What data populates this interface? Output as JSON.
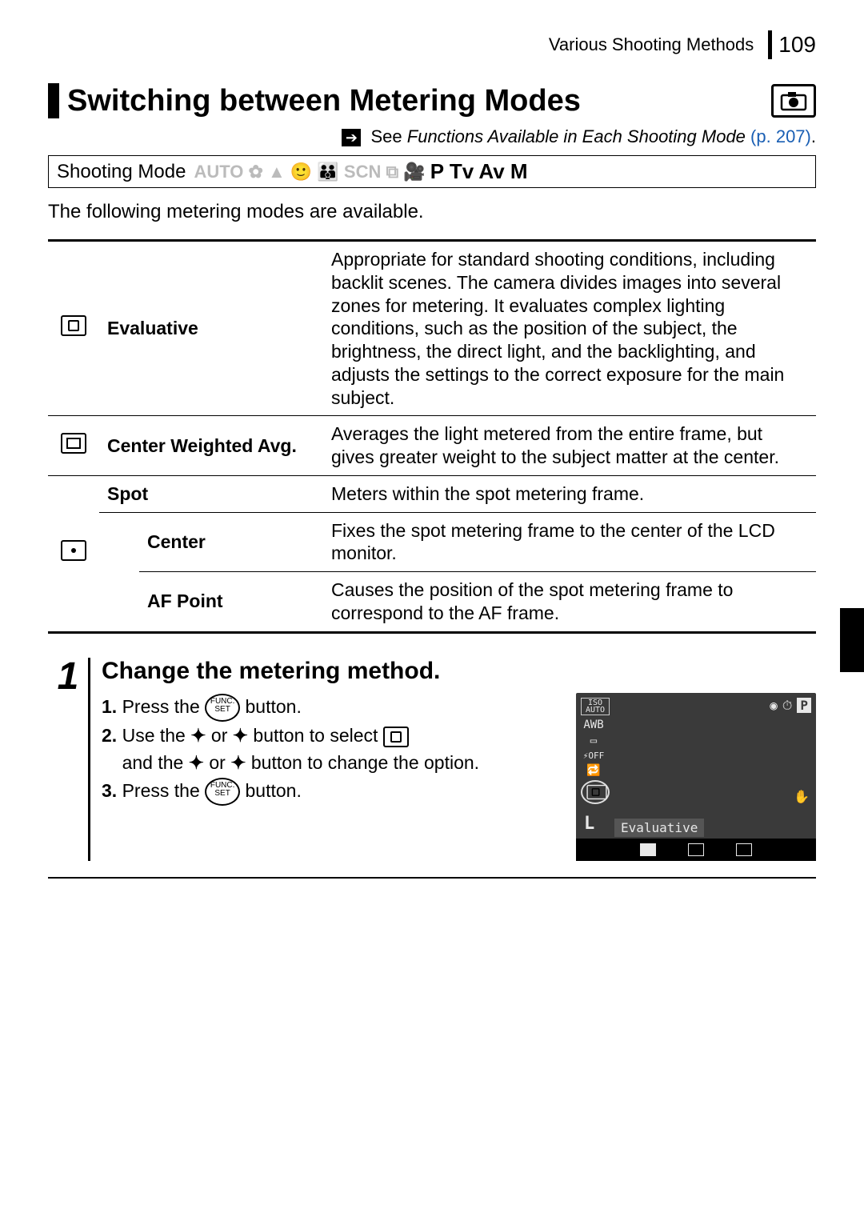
{
  "header": {
    "section_title": "Various Shooting Methods",
    "page_number": "109"
  },
  "heading": "Switching between Metering Modes",
  "see_ref": {
    "prefix": "See",
    "title": "Functions Available in Each Shooting Mode",
    "page": "(p. 207)",
    "period": "."
  },
  "shooting_mode": {
    "label": "Shooting Mode",
    "inactive_modes": "AUTO ✿ ▲ 🙂 👪 SCN ⧉ 🎥",
    "active_modes": "P Tv Av M"
  },
  "intro": "The following metering modes are available.",
  "table": {
    "evaluative": {
      "name": "Evaluative",
      "desc": "Appropriate for standard shooting conditions, including backlit scenes. The camera divides images into several zones for metering. It evaluates complex lighting conditions, such as the position of the subject, the brightness, the direct light, and the backlighting, and adjusts the settings to the correct exposure for the main subject."
    },
    "center_weighted": {
      "name": "Center Weighted Avg.",
      "desc": "Averages the light metered from the entire frame, but gives greater weight to the subject matter at the center."
    },
    "spot": {
      "name": "Spot",
      "desc": "Meters within the spot metering frame."
    },
    "spot_center": {
      "name": "Center",
      "desc": "Fixes the spot metering frame to the center of the LCD monitor."
    },
    "spot_af": {
      "name": "AF Point",
      "desc": "Causes the position of the spot metering frame to correspond to the AF frame."
    }
  },
  "step": {
    "number": "1",
    "title": "Change the metering method.",
    "s1_a": "Press the",
    "s1_b": "button.",
    "s2_a": "Use the",
    "s2_b": "or",
    "s2_c": "button to select",
    "s2_d": "and the",
    "s2_e": "or",
    "s2_f": "button to change the option.",
    "s3_a": "Press the",
    "s3_b": "button.",
    "func_top": "FUNC.",
    "func_bot": "SET"
  },
  "screen": {
    "left_icons": [
      "ISO\nAUTO",
      "AWB",
      "▭",
      "⚡OFF",
      "🔁"
    ],
    "selected_icon": "◉",
    "top_right": [
      "◉",
      "⏱"
    ],
    "p_label": "P",
    "label": "Evaluative",
    "left_l": "L",
    "right_hand": "✋"
  }
}
